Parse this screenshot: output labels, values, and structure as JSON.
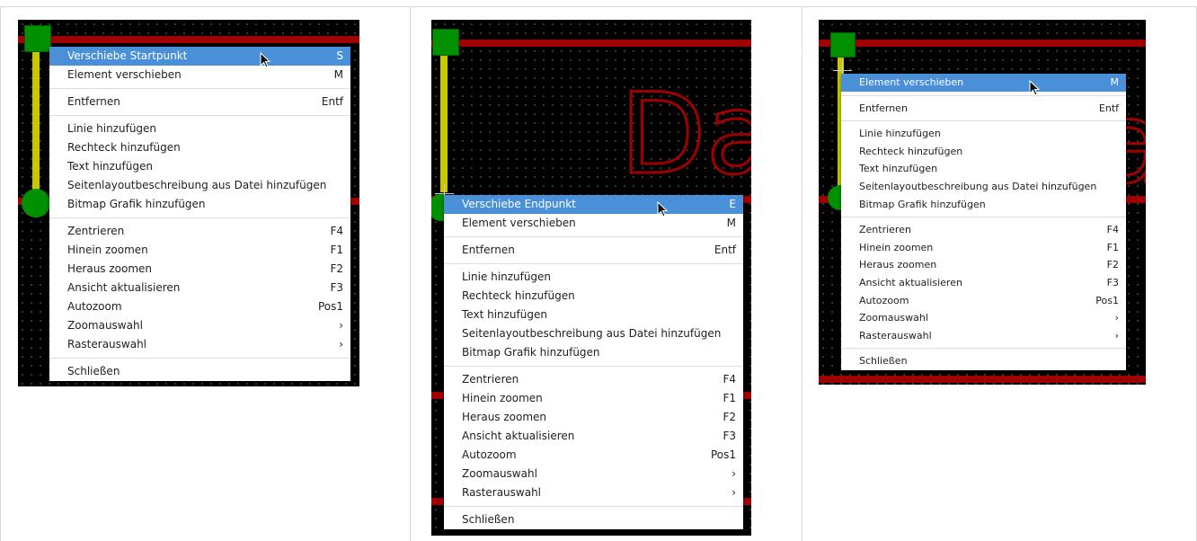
{
  "colors": {
    "canvas": "#000000",
    "rail": "#a00000",
    "pad": "#009000",
    "trace": "#c8c800",
    "highlight": "#4a90d9"
  },
  "panels": [
    {
      "menu": {
        "items": [
          {
            "label": "Verschiebe Startpunkt",
            "shortcut": "S",
            "highlighted": true
          },
          {
            "label": "Element verschieben",
            "shortcut": "M"
          },
          {
            "sep": true
          },
          {
            "label": "Entfernen",
            "shortcut": "Entf"
          },
          {
            "sep": true
          },
          {
            "label": "Linie hinzufügen",
            "shortcut": ""
          },
          {
            "label": "Rechteck hinzufügen",
            "shortcut": ""
          },
          {
            "label": "Text hinzufügen",
            "shortcut": ""
          },
          {
            "label": "Seitenlayoutbeschreibung aus Datei hinzufügen",
            "shortcut": ""
          },
          {
            "label": "Bitmap Grafik hinzufügen",
            "shortcut": ""
          },
          {
            "sep": true
          },
          {
            "label": "Zentrieren",
            "shortcut": "F4"
          },
          {
            "label": "Hinein zoomen",
            "shortcut": "F1"
          },
          {
            "label": "Heraus zoomen",
            "shortcut": "F2"
          },
          {
            "label": "Ansicht aktualisieren",
            "shortcut": "F3"
          },
          {
            "label": "Autozoom",
            "shortcut": "Pos1"
          },
          {
            "label": "Zoomauswahl",
            "shortcut": "›"
          },
          {
            "label": "Rasterauswahl",
            "shortcut": "›"
          },
          {
            "sep": true
          },
          {
            "label": "Schließen",
            "shortcut": ""
          }
        ]
      }
    },
    {
      "canvas_text": "Da",
      "menu": {
        "items": [
          {
            "label": "Verschiebe Endpunkt",
            "shortcut": "E",
            "highlighted": true
          },
          {
            "label": "Element verschieben",
            "shortcut": "M"
          },
          {
            "sep": true
          },
          {
            "label": "Entfernen",
            "shortcut": "Entf"
          },
          {
            "sep": true
          },
          {
            "label": "Linie hinzufügen",
            "shortcut": ""
          },
          {
            "label": "Rechteck hinzufügen",
            "shortcut": ""
          },
          {
            "label": "Text hinzufügen",
            "shortcut": ""
          },
          {
            "label": "Seitenlayoutbeschreibung aus Datei hinzufügen",
            "shortcut": ""
          },
          {
            "label": "Bitmap Grafik hinzufügen",
            "shortcut": ""
          },
          {
            "sep": true
          },
          {
            "label": "Zentrieren",
            "shortcut": "F4"
          },
          {
            "label": "Hinein zoomen",
            "shortcut": "F1"
          },
          {
            "label": "Heraus zoomen",
            "shortcut": "F2"
          },
          {
            "label": "Ansicht aktualisieren",
            "shortcut": "F3"
          },
          {
            "label": "Autozoom",
            "shortcut": "Pos1"
          },
          {
            "label": "Zoomauswahl",
            "shortcut": "›"
          },
          {
            "label": "Rasterauswahl",
            "shortcut": "›"
          },
          {
            "sep": true
          },
          {
            "label": "Schließen",
            "shortcut": ""
          }
        ]
      }
    },
    {
      "menu": {
        "items": [
          {
            "label": "Element verschieben",
            "shortcut": "M",
            "highlighted": true
          },
          {
            "sep": true
          },
          {
            "label": "Entfernen",
            "shortcut": "Entf"
          },
          {
            "sep": true
          },
          {
            "label": "Linie hinzufügen",
            "shortcut": ""
          },
          {
            "label": "Rechteck hinzufügen",
            "shortcut": ""
          },
          {
            "label": "Text hinzufügen",
            "shortcut": ""
          },
          {
            "label": "Seitenlayoutbeschreibung aus Datei hinzufügen",
            "shortcut": ""
          },
          {
            "label": "Bitmap Grafik hinzufügen",
            "shortcut": ""
          },
          {
            "sep": true
          },
          {
            "label": "Zentrieren",
            "shortcut": "F4"
          },
          {
            "label": "Hinein zoomen",
            "shortcut": "F1"
          },
          {
            "label": "Heraus zoomen",
            "shortcut": "F2"
          },
          {
            "label": "Ansicht aktualisieren",
            "shortcut": "F3"
          },
          {
            "label": "Autozoom",
            "shortcut": "Pos1"
          },
          {
            "label": "Zoomauswahl",
            "shortcut": "›"
          },
          {
            "label": "Rasterauswahl",
            "shortcut": "›"
          },
          {
            "sep": true
          },
          {
            "label": "Schließen",
            "shortcut": ""
          }
        ]
      }
    }
  ]
}
